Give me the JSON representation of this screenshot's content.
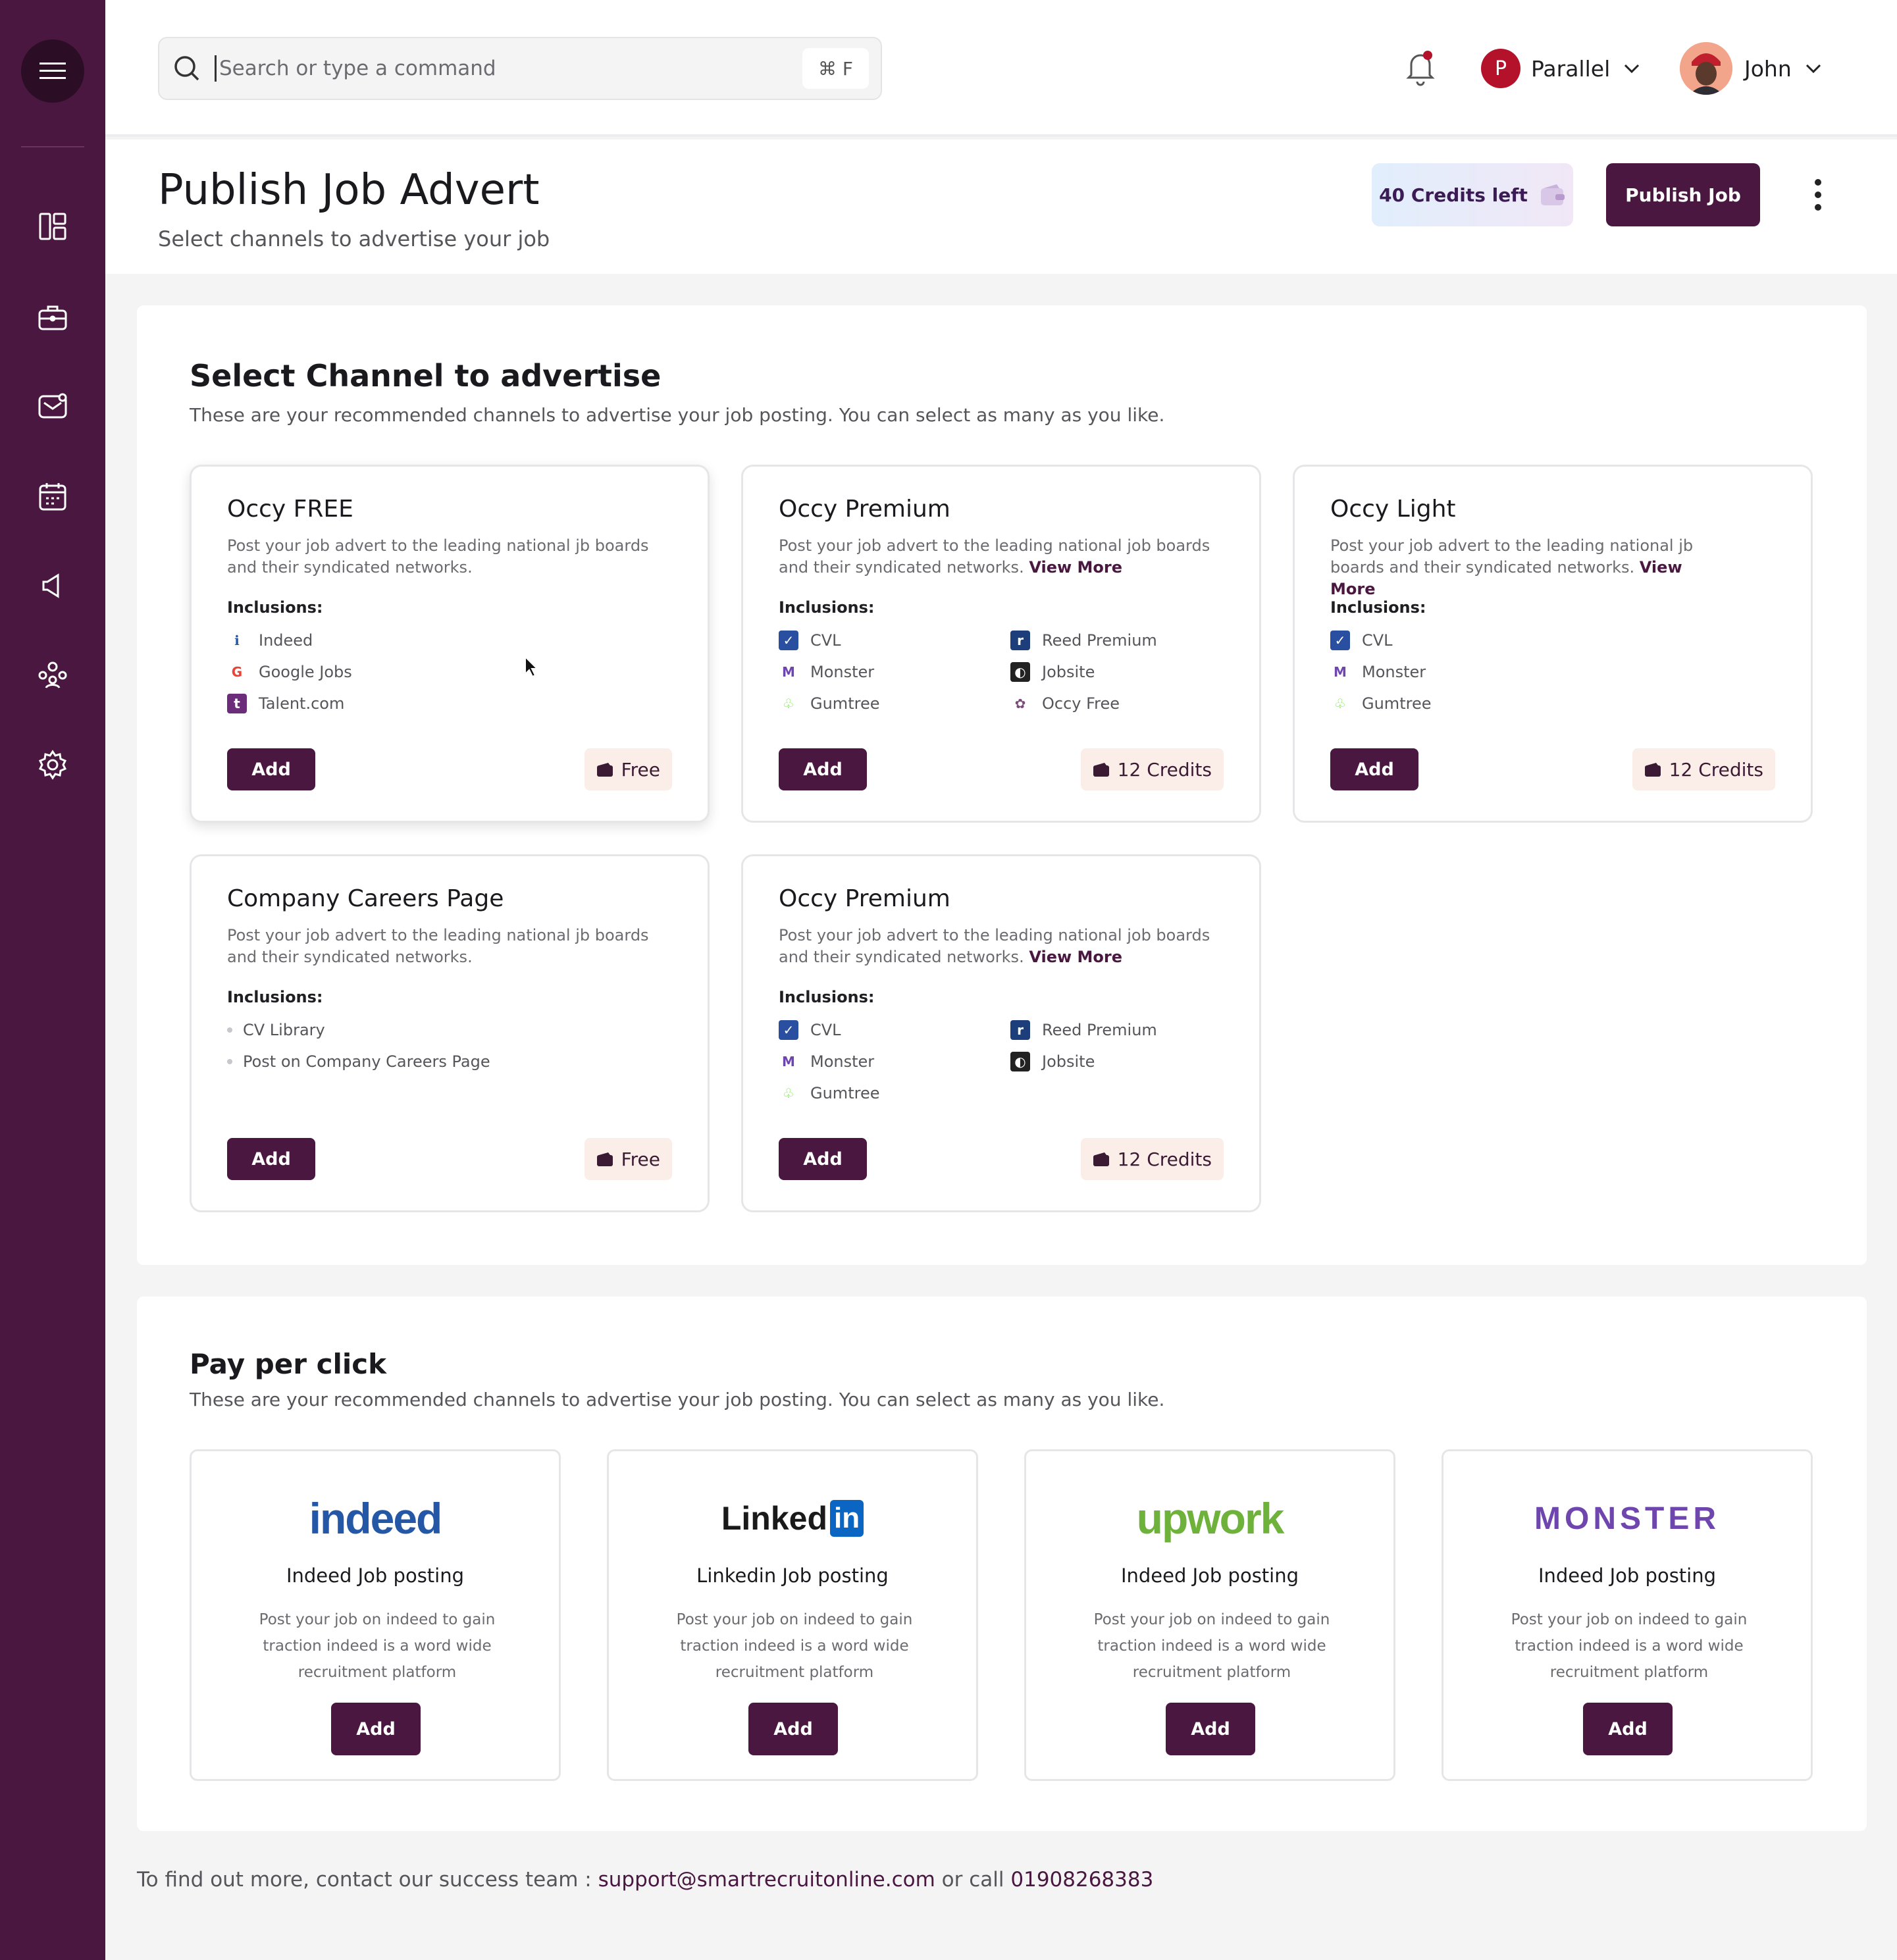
{
  "search": {
    "placeholder": "Search or type a command",
    "shortcut": "⌘ F"
  },
  "topbar": {
    "org_initial": "P",
    "org_name": "Parallel",
    "user_name": "John"
  },
  "header": {
    "title": "Publish Job Advert",
    "subtitle": "Select channels to advertise your job",
    "credits": "40 Credits left",
    "publish_label": "Publish Job"
  },
  "channels": {
    "title": "Select Channel to advertise",
    "subtitle": "These are your recommended channels to advertise your job posting. You can select as many  as you like.",
    "inclusions_label": "Inclusions:",
    "add_label": "Add",
    "view_more": "View More",
    "cards": [
      {
        "title": "Occy FREE",
        "description": "Post your job advert to the leading national jb boards and their syndicated networks.",
        "items": [
          "Indeed",
          "Google Jobs",
          "Talent.com"
        ],
        "price": "Free"
      },
      {
        "title": "Occy Premium",
        "description": "Post your job advert to the leading national job boards and their syndicated networks.",
        "items": [
          "CVL",
          "Monster",
          "Gumtree",
          "Reed Premium",
          "Jobsite",
          "Occy Free"
        ],
        "price": "12 Credits"
      },
      {
        "title": "Occy Light",
        "description": "Post your job advert to the leading national jb boards and their syndicated networks.",
        "items": [
          "CVL",
          "Monster",
          "Gumtree"
        ],
        "price": "12 Credits"
      },
      {
        "title": "Company Careers Page",
        "description": "Post your job advert to the leading national jb boards and their syndicated networks.",
        "items": [
          "CV Library",
          "Post on Company Careers Page"
        ],
        "price": "Free"
      },
      {
        "title": "Occy Premium",
        "description": "Post your job advert to the leading national job boards and their syndicated networks.",
        "items": [
          "CVL",
          "Monster",
          "Gumtree",
          "Reed Premium",
          "Jobsite"
        ],
        "price": "12 Credits"
      }
    ]
  },
  "ppc": {
    "title": "Pay per click",
    "subtitle": "These are your recommended channels to advertise your job posting. You can select as many  as you like.",
    "add_label": "Add",
    "cards": [
      {
        "logo": "indeed",
        "title": "Indeed Job posting",
        "description": "Post your job on indeed to gain traction indeed is a word wide recruitment platform"
      },
      {
        "logo": "Linked",
        "logo_suffix": "in",
        "title": "Linkedin Job posting",
        "description": "Post your job on indeed to gain traction indeed is a word wide recruitment platform"
      },
      {
        "logo": "upwork",
        "title": "Indeed Job posting",
        "description": "Post your job on indeed to gain traction indeed is a word wide recruitment platform"
      },
      {
        "logo": "MONSTER",
        "title": "Indeed Job posting",
        "description": "Post your job on indeed to gain traction indeed is a word wide recruitment platform"
      }
    ]
  },
  "footer": {
    "text": "To find out more, contact our success team : ",
    "email": "support@smartrecruitonline.com",
    "or_call": " or call ",
    "phone": "01908268383"
  },
  "colors": {
    "brand": "#4a1740",
    "sidebar": "#4a1740",
    "price_chip": "#fbeee8",
    "notification": "#b3122a"
  }
}
